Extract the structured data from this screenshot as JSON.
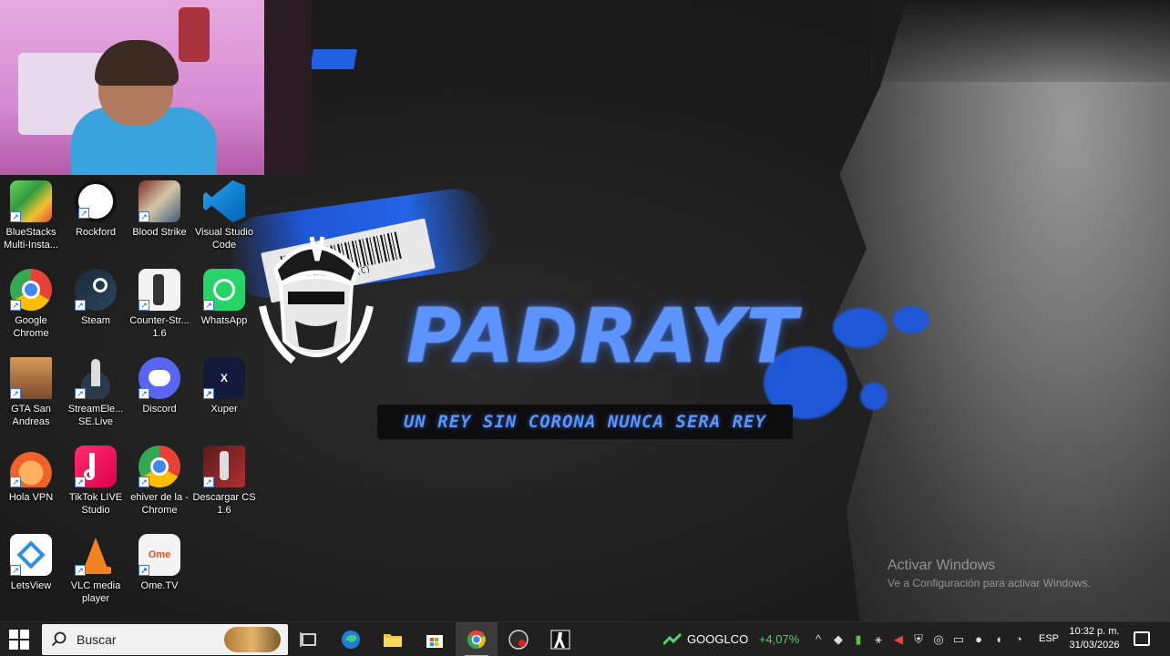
{
  "wallpaper": {
    "title": "PADRAYT",
    "slogan": "UN REY SIN CORONA NUNCA SERA REY",
    "barcode_text": "56B-789(C)",
    "accent_color": "#2464e6"
  },
  "watermark": {
    "line1": "Activar Windows",
    "line2": "Ve a Configuración para activar Windows."
  },
  "desktop_icons": [
    {
      "label": "BlueStacks Multi-Insta...",
      "icon": "bluestacks-icon"
    },
    {
      "label": "Rockford",
      "icon": "rockford-icon"
    },
    {
      "label": "Blood Strike",
      "icon": "blood-strike-icon"
    },
    {
      "label": "Visual Studio Code",
      "icon": "vscode-icon"
    },
    {
      "label": "Google Chrome",
      "icon": "chrome-icon"
    },
    {
      "label": "Steam",
      "icon": "steam-icon"
    },
    {
      "label": "Counter-Str... 1.6",
      "icon": "counter-strike-icon"
    },
    {
      "label": "WhatsApp",
      "icon": "whatsapp-icon"
    },
    {
      "label": "GTA San Andreas",
      "icon": "gta-icon"
    },
    {
      "label": "StreamEle... SE.Live",
      "icon": "streamelements-icon"
    },
    {
      "label": "Discord",
      "icon": "discord-icon"
    },
    {
      "label": "Xuper",
      "icon": "xuper-icon"
    },
    {
      "label": "Hola VPN",
      "icon": "hola-vpn-icon"
    },
    {
      "label": "TikTok LIVE Studio",
      "icon": "tiktok-icon"
    },
    {
      "label": "ehiver de la - Chrome",
      "icon": "chrome-profile-icon"
    },
    {
      "label": "Descargar CS 1.6",
      "icon": "cs-download-icon"
    },
    {
      "label": "LetsView",
      "icon": "letsview-icon"
    },
    {
      "label": "VLC media player",
      "icon": "vlc-icon"
    },
    {
      "label": "Ome.TV",
      "icon": "ometv-icon"
    }
  ],
  "taskbar": {
    "search_placeholder": "Buscar",
    "apps": [
      "task-view-icon",
      "edge-icon",
      "file-explorer-icon",
      "store-icon",
      "chrome-icon",
      "obs-icon",
      "counter-strike-icon"
    ],
    "ticker": {
      "name": "GOOGLCO",
      "change": "+4,07%",
      "color": "#4cd36a"
    },
    "language": "ESP",
    "time": "10:32 p. m.",
    "date": "31/03/2026"
  }
}
